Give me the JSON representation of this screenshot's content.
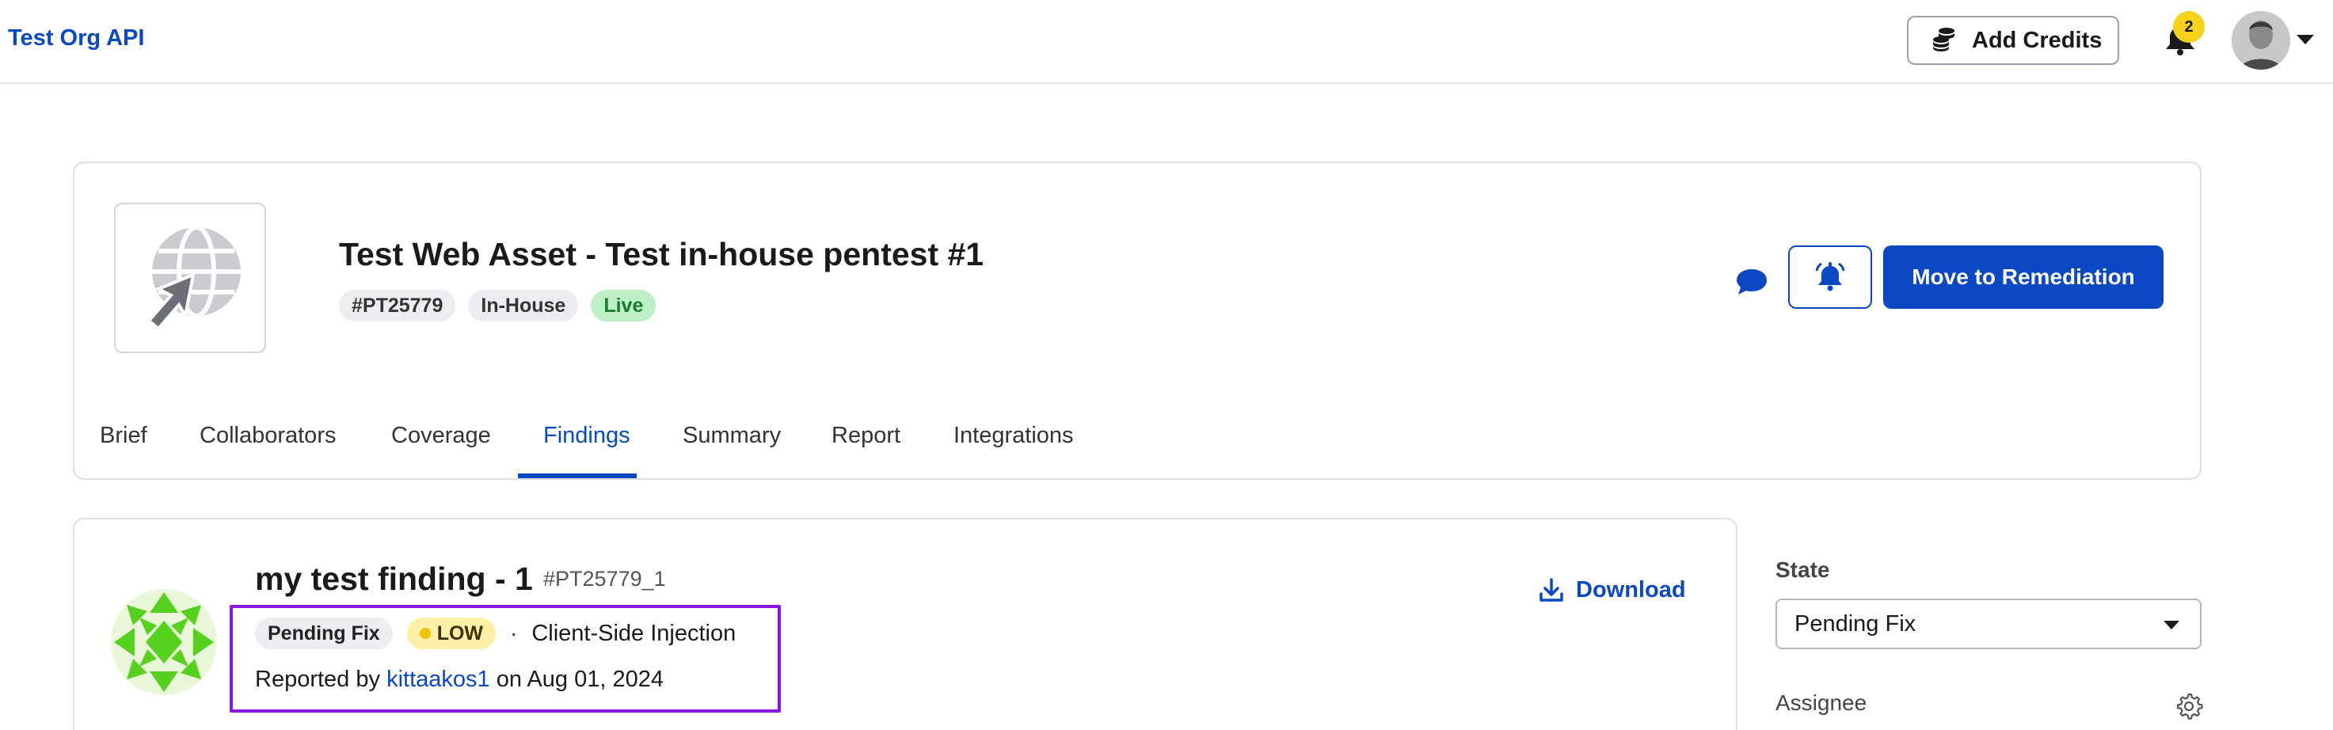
{
  "topbar": {
    "org_name": "Test Org API",
    "add_credits_label": "Add Credits",
    "notification_count": "2"
  },
  "asset": {
    "title": "Test Web Asset - Test in-house pentest #1",
    "tags": [
      "#PT25779",
      "In-House",
      "Live"
    ],
    "move_button_label": "Move to Remediation"
  },
  "tabs": [
    {
      "label": "Brief",
      "active": false
    },
    {
      "label": "Collaborators",
      "active": false
    },
    {
      "label": "Coverage",
      "active": false
    },
    {
      "label": "Findings",
      "active": true
    },
    {
      "label": "Summary",
      "active": false
    },
    {
      "label": "Report",
      "active": false
    },
    {
      "label": "Integrations",
      "active": false
    }
  ],
  "finding": {
    "title": "my test finding - 1",
    "id": "#PT25779_1",
    "download_label": "Download",
    "state_pill": "Pending Fix",
    "severity": "LOW",
    "separator": "·",
    "category": "Client-Side Injection",
    "reported_prefix": "Reported by",
    "reporter": "kittaakos1",
    "reported_suffix": "on Aug 01, 2024"
  },
  "sidepanel": {
    "state_label": "State",
    "state_value": "Pending Fix",
    "assignee_label": "Assignee"
  },
  "colors": {
    "accent": "#0a48c4",
    "highlight": "#8a14e0",
    "live_bg": "#bdf0c6",
    "low_bg": "#fbf0a6",
    "badge": "#f6d21a"
  },
  "icons": [
    "coins-icon",
    "bell-icon",
    "caret-down-icon",
    "globe-cursor-icon",
    "chat-icon",
    "bell-ring-icon",
    "download-icon",
    "gear-icon"
  ]
}
